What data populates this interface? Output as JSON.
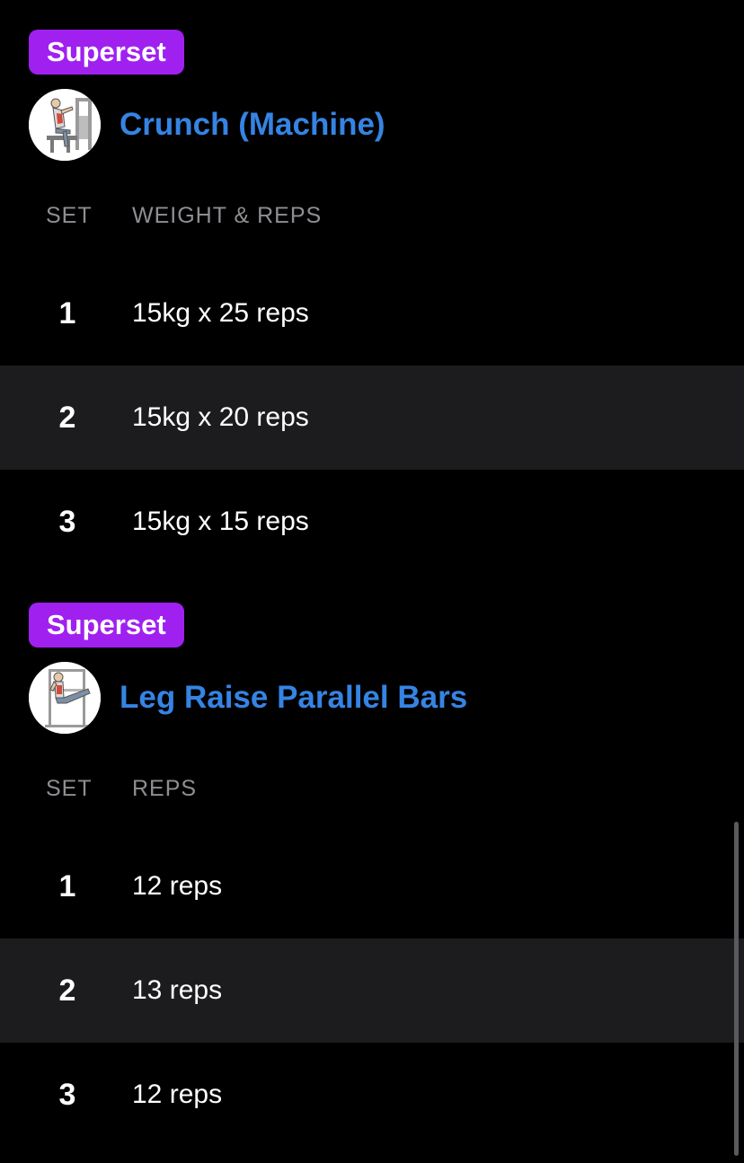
{
  "exercises": [
    {
      "badge": "Superset",
      "title": "Crunch (Machine)",
      "headers": {
        "set": "SET",
        "value": "WEIGHT & REPS"
      },
      "rows": [
        {
          "set": "1",
          "value": "15kg x 25 reps"
        },
        {
          "set": "2",
          "value": "15kg x 20 reps"
        },
        {
          "set": "3",
          "value": "15kg x 15 reps"
        }
      ]
    },
    {
      "badge": "Superset",
      "title": "Leg Raise Parallel Bars",
      "headers": {
        "set": "SET",
        "value": "REPS"
      },
      "rows": [
        {
          "set": "1",
          "value": "12 reps"
        },
        {
          "set": "2",
          "value": "13 reps"
        },
        {
          "set": "3",
          "value": "12 reps"
        }
      ]
    }
  ],
  "colors": {
    "background": "#000000",
    "badge": "#a020f0",
    "title": "#3584e4",
    "header_text": "#8e8e93",
    "alt_row": "#1c1c1e"
  },
  "icons": [
    "crunch-machine-thumbnail",
    "leg-raise-thumbnail"
  ]
}
